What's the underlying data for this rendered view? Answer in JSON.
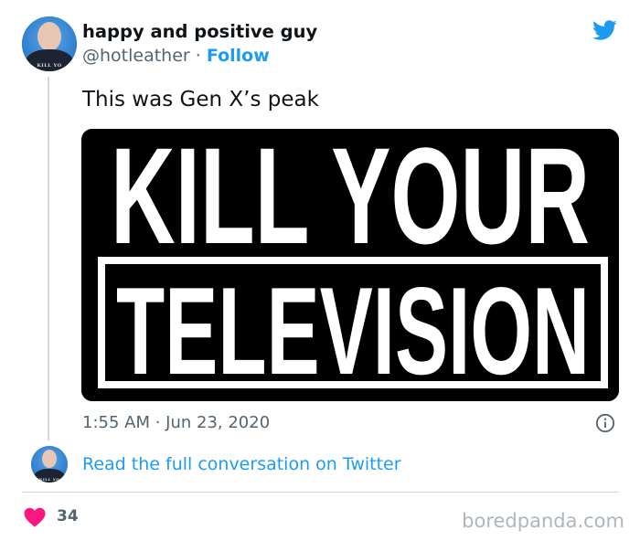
{
  "tweet": {
    "author": {
      "display_name": "happy and positive guy",
      "handle": "@hotleather",
      "separator": " · ",
      "follow_label": "Follow",
      "avatar_shirt_text": "KILL YO"
    },
    "text": "This was Gen X’s peak",
    "media": {
      "line1": "KILL YOUR",
      "line2": "TELEVISION"
    },
    "timestamp": "1:55 AM · Jun 23, 2020",
    "read_full_label": "Read the full conversation on Twitter",
    "like_count": "34"
  },
  "watermark": "boredpanda.com",
  "colors": {
    "accent": "#1d9bf0",
    "heart": "#f91880",
    "secondary_text": "#536471",
    "divider": "#cfd9de"
  },
  "icons": {
    "brand": "twitter-bird-icon",
    "info": "info-icon",
    "like": "heart-icon"
  }
}
